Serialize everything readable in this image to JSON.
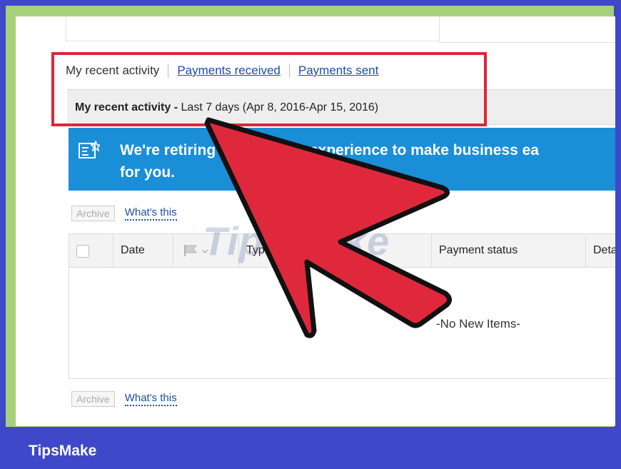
{
  "tabs": {
    "active": "My recent activity",
    "payments_received": "Payments received",
    "payments_sent": "Payments sent"
  },
  "subheader": {
    "bold": "My recent activity -",
    "range": "Last 7 days (Apr 8, 2016-Apr 15, 2016)"
  },
  "banner": {
    "text": "We're retiring our account experience to make business ea",
    "text2": "for you.",
    "icon": "notice-icon"
  },
  "toolbar": {
    "archive": "Archive",
    "whats_this": "What's this"
  },
  "table": {
    "columns": [
      "Date",
      "Type",
      "Payment status",
      "Deta"
    ],
    "empty_message": "-No New Items-"
  },
  "watermark": "TipsMake",
  "footer": {
    "brand": "TipsMake"
  },
  "colors": {
    "frame": "#3f48c8",
    "border_green": "#a8cf7a",
    "highlight": "#d8283a",
    "banner": "#1b8ed8",
    "link": "#1a4fa6",
    "arrow": "#e0283c"
  }
}
